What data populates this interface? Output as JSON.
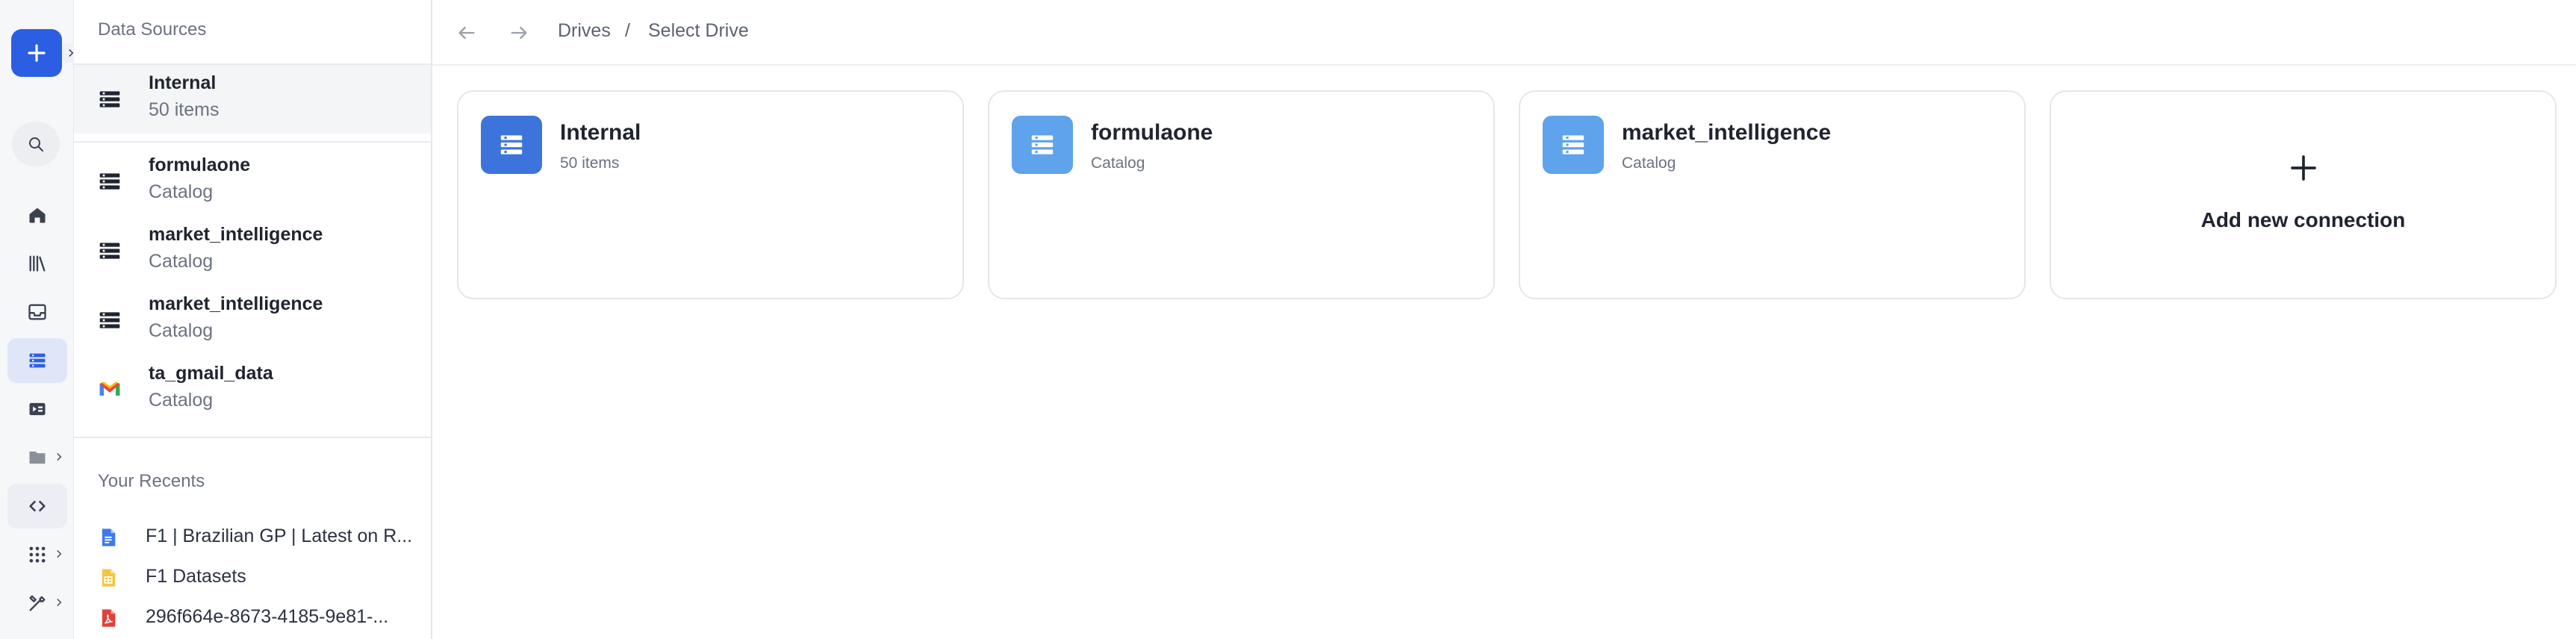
{
  "sidebar": {
    "panel_title": "Data Sources",
    "data_sources": [
      {
        "name": "Internal",
        "subtitle": "50 items",
        "icon": "table-list-icon"
      },
      {
        "name": "formulaone",
        "subtitle": "Catalog",
        "icon": "table-list-icon"
      },
      {
        "name": "market_intelligence",
        "subtitle": "Catalog",
        "icon": "table-list-icon"
      },
      {
        "name": "market_intelligence",
        "subtitle": "Catalog",
        "icon": "table-list-icon"
      },
      {
        "name": "ta_gmail_data",
        "subtitle": "Catalog",
        "icon": "gmail-icon"
      }
    ],
    "recents_title": "Your Recents",
    "recents": [
      {
        "label": "F1 | Brazilian GP | Latest on R...",
        "icon": "document-icon",
        "color": "#3f7be8"
      },
      {
        "label": "F1 Datasets",
        "icon": "spreadsheet-icon",
        "color": "#f4c542"
      },
      {
        "label": "296f664e-8673-4185-9e81-...",
        "icon": "pdf-icon",
        "color": "#e0423a"
      }
    ]
  },
  "topbar": {
    "breadcrumb": [
      "Drives",
      "Select Drive"
    ],
    "separator": "/"
  },
  "drives": [
    {
      "name": "Internal",
      "subtitle": "50 items",
      "icon_color": "#3d74dc"
    },
    {
      "name": "formulaone",
      "subtitle": "Catalog",
      "icon_color": "#5ea3ec"
    },
    {
      "name": "market_intelligence",
      "subtitle": "Catalog",
      "icon_color": "#5ea3ec"
    }
  ],
  "add_connection": {
    "label": "Add new connection"
  },
  "colors": {
    "accent": "#2c5ee3",
    "active_nav_bg": "#dfe6f7"
  }
}
